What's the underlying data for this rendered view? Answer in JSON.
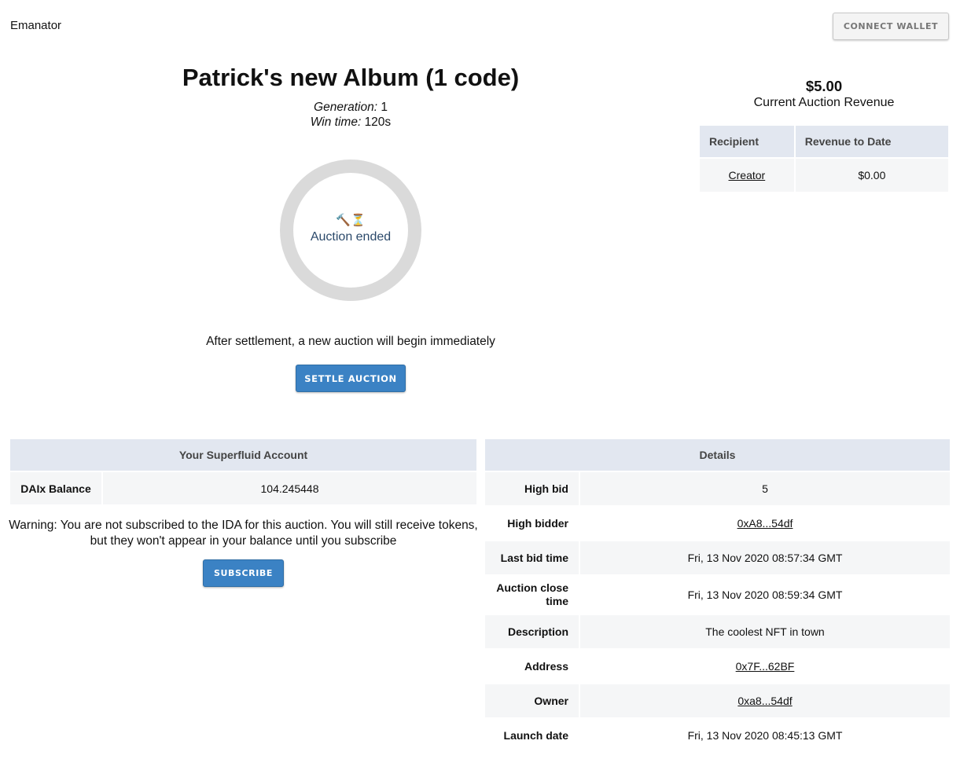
{
  "header": {
    "brand": "Emanator",
    "connect_wallet_label": "CONNECT WALLET"
  },
  "auction": {
    "title": "Patrick's new Album (1 code)",
    "generation_label": "Generation:",
    "generation_value": "1",
    "win_time_label": "Win time:",
    "win_time_value": "120s",
    "status_icons": "🔨⏳",
    "status_text": "Auction ended",
    "settlement_note": "After settlement, a new auction will begin immediately",
    "settle_button_label": "SETTLE AUCTION"
  },
  "revenue": {
    "amount": "$5.00",
    "label": "Current Auction Revenue",
    "columns": [
      "Recipient",
      "Revenue to Date"
    ],
    "rows": [
      {
        "recipient": "Creator",
        "revenue": "$0.00"
      }
    ]
  },
  "account": {
    "heading": "Your Superfluid Account",
    "balance_label": "DAIx Balance",
    "balance_value": "104.245448",
    "warning": "Warning: You are not subscribed to the IDA for this auction. You will still receive tokens, but they won't appear in your balance until you subscribe",
    "subscribe_button_label": "SUBSCRIBE"
  },
  "details": {
    "heading": "Details",
    "rows": [
      {
        "label": "High bid",
        "value": "5"
      },
      {
        "label": "High bidder",
        "value": "0xA8...54df"
      },
      {
        "label": "Last bid time",
        "value": "Fri, 13 Nov 2020 08:57:34 GMT"
      },
      {
        "label": "Auction close time",
        "value": "Fri, 13 Nov 2020 08:59:34 GMT"
      },
      {
        "label": "Description",
        "value": "The coolest NFT in town"
      },
      {
        "label": "Address",
        "value": "0x7F...62BF"
      },
      {
        "label": "Owner",
        "value": "0xa8...54df"
      },
      {
        "label": "Launch date",
        "value": "Fri, 13 Nov 2020 08:45:13 GMT"
      }
    ]
  },
  "colors": {
    "primary_button": "#3b82c4",
    "table_header": "#e2e7f0",
    "table_row_alt": "#f5f6f7",
    "progress_ring": "#dadada",
    "status_text": "#2c4a6b"
  }
}
